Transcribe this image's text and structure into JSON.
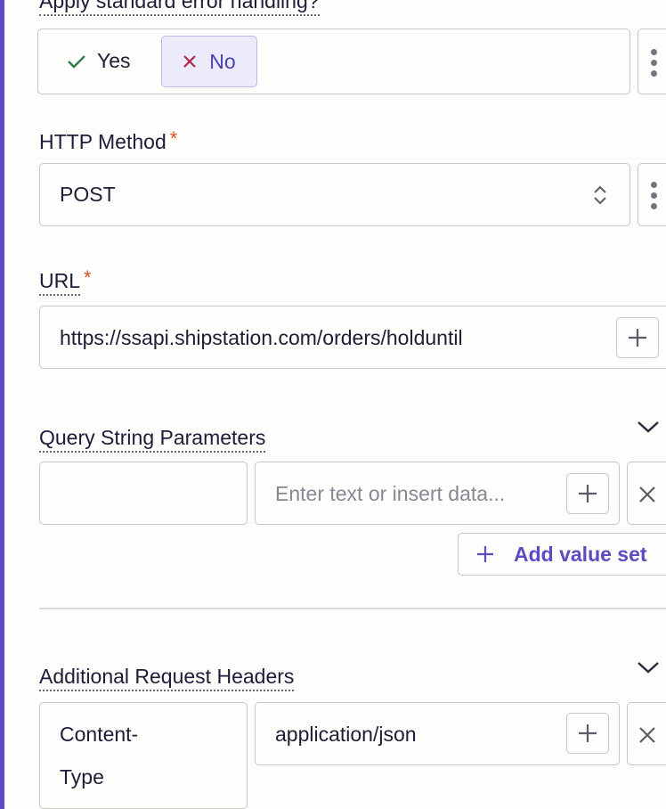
{
  "error_handling": {
    "label": "Apply standard error handling?",
    "required_mark": "*",
    "yes_label": "Yes",
    "no_label": "No",
    "selected": "No"
  },
  "http_method": {
    "label": "HTTP Method",
    "required_mark": "*",
    "value": "POST"
  },
  "url": {
    "label": "URL",
    "required_mark": "*",
    "value": "https://ssapi.shipstation.com/orders/holduntil"
  },
  "query_params": {
    "label": "Query String Parameters",
    "rows": [
      {
        "key": "",
        "value_placeholder": "Enter text or insert data..."
      }
    ],
    "add_label": "Add value set"
  },
  "headers": {
    "label": "Additional Request Headers",
    "rows": [
      {
        "key_line1": "Content-",
        "key_line2": "Type",
        "value": "application/json"
      }
    ]
  },
  "colors": {
    "accent": "#5b4bc4",
    "required": "#d4561b",
    "yes_check": "#2e7d4f",
    "no_x": "#b3264b",
    "selected_bg": "#ecebf9"
  }
}
